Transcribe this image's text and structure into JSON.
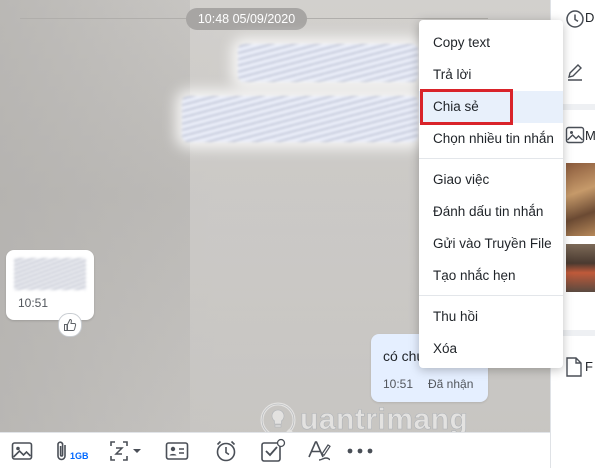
{
  "chat": {
    "timestamp": "10:48 05/09/2020",
    "received_message": {
      "time": "10:51"
    },
    "sent_message": {
      "text": "có chu",
      "time": "10:51",
      "status": "Đã nhận"
    }
  },
  "context_menu": {
    "group1": [
      "Copy text",
      "Trả lời",
      "Chia sẻ",
      "Chọn nhiều tin nhắn"
    ],
    "group2": [
      "Giao việc",
      "Đánh dấu tin nhắn",
      "Gửi vào Truyền File",
      "Tạo nhắc hẹn"
    ],
    "group3": [
      "Thu hồi",
      "Xóa"
    ],
    "highlighted": "Chia sẻ"
  },
  "toolbar": {
    "file_size_label": "1GB",
    "icons": [
      "image-icon",
      "attach-file-icon",
      "screenshot-icon",
      "contact-card-icon",
      "reminder-clock-icon",
      "todo-check-icon",
      "font-format-icon",
      "more-options-icon"
    ]
  },
  "side_panel": {
    "section1_label": "D",
    "section2_label": "M",
    "section3_label": "F"
  },
  "watermark": {
    "text": "uantrimang",
    "glyph": "Q"
  },
  "colors": {
    "highlight_border": "#d9232a",
    "sent_bubble": "#e5efff",
    "accent": "#0068ff",
    "menu_active_bg": "#e8f0fb"
  }
}
